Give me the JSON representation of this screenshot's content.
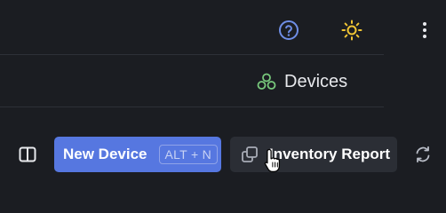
{
  "header": {
    "help_icon": "help-circle-icon",
    "theme_icon": "sun-icon",
    "menu_icon": "more-vertical-icon"
  },
  "breadcrumb": {
    "icon": "devices-cluster-icon",
    "label": "Devices"
  },
  "toolbar": {
    "sidebar_toggle_icon": "split-panel-icon",
    "new_device_label": "New Device",
    "new_device_shortcut": "ALT + N",
    "inventory_icon": "copy-icon",
    "inventory_label": "Inventory Report",
    "refresh_icon": "refresh-icon"
  },
  "colors": {
    "background": "#1b1d22",
    "primary": "#5677e0",
    "secondary_button": "#2b2e35",
    "help_icon": "#6f8ee6",
    "sun_icon": "#f0c534",
    "devices_icon": "#78c97c"
  }
}
